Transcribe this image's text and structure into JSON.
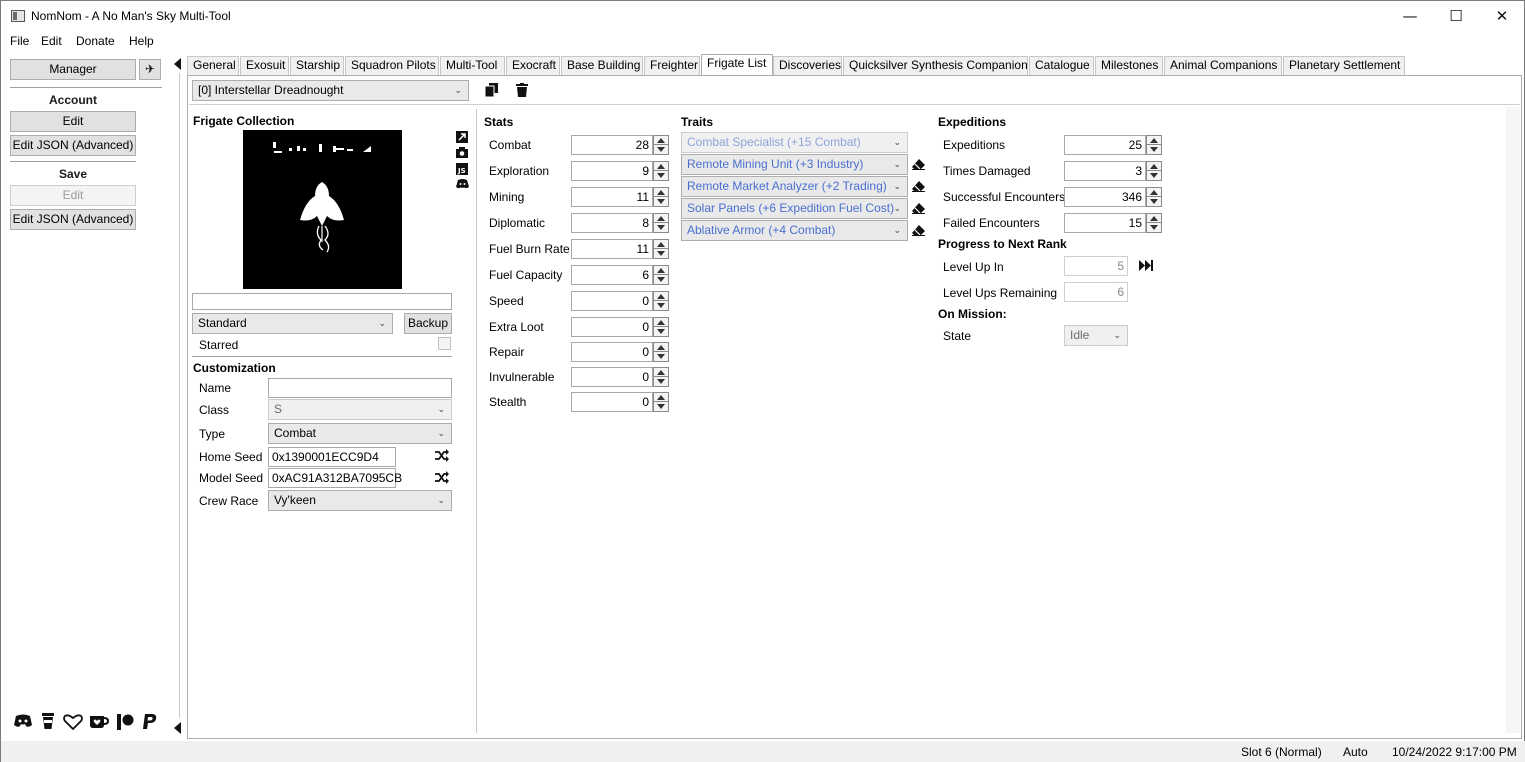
{
  "window": {
    "title": "NomNom - A No Man's Sky Multi-Tool",
    "minimize": "—",
    "maximize": "☐",
    "close": "✕"
  },
  "menu": [
    "File",
    "Edit",
    "Donate",
    "Help"
  ],
  "left": {
    "manager_label": "Manager",
    "account_label": "Account",
    "account_edit": "Edit",
    "account_edit_json": "Edit JSON (Advanced)",
    "save_label": "Save",
    "save_edit": "Edit",
    "save_edit_json": "Edit JSON (Advanced)"
  },
  "tabs": [
    "General",
    "Exosuit",
    "Starship",
    "Squadron Pilots",
    "Multi-Tool",
    "Exocraft",
    "Base Building",
    "Freighter",
    "Frigate List",
    "Discoveries",
    "Quicksilver Synthesis Companion",
    "Catalogue",
    "Milestones",
    "Animal Companions",
    "Planetary Settlement"
  ],
  "active_tab": "Frigate List",
  "frigate_selector": "[0] Interstellar Dreadnought",
  "collection": {
    "header": "Frigate Collection",
    "name_value": "",
    "mode": "Standard",
    "backup": "Backup",
    "starred": "Starred"
  },
  "customization": {
    "header": "Customization",
    "name_label": "Name",
    "name_value": "",
    "class_label": "Class",
    "class_value": "S",
    "type_label": "Type",
    "type_value": "Combat",
    "home_seed_label": "Home Seed",
    "home_seed_value": "0x1390001ECC9D4",
    "model_seed_label": "Model Seed",
    "model_seed_value": "0xAC91A312BA7095CB",
    "crew_race_label": "Crew Race",
    "crew_race_value": "Vy'keen"
  },
  "stats": {
    "header": "Stats",
    "items": [
      {
        "label": "Combat",
        "value": "28"
      },
      {
        "label": "Exploration",
        "value": "9"
      },
      {
        "label": "Mining",
        "value": "11"
      },
      {
        "label": "Diplomatic",
        "value": "8"
      },
      {
        "label": "Fuel Burn Rate",
        "value": "11"
      },
      {
        "label": "Fuel Capacity",
        "value": "6"
      },
      {
        "label": "Speed",
        "value": "0"
      },
      {
        "label": "Extra Loot",
        "value": "0"
      },
      {
        "label": "Repair",
        "value": "0"
      },
      {
        "label": "Invulnerable",
        "value": "0"
      },
      {
        "label": "Stealth",
        "value": "0"
      }
    ]
  },
  "traits": {
    "header": "Traits",
    "items": [
      "Combat Specialist (+15 Combat)",
      "Remote Mining Unit (+3 Industry)",
      "Remote Market Analyzer (+2 Trading)",
      "Solar Panels (+6 Expedition Fuel Cost)",
      "Ablative Armor (+4 Combat)"
    ]
  },
  "expeditions": {
    "header": "Expeditions",
    "items": [
      {
        "label": "Expeditions",
        "value": "25"
      },
      {
        "label": "Times Damaged",
        "value": "3"
      },
      {
        "label": "Successful Encounters",
        "value": "346"
      },
      {
        "label": "Failed Encounters",
        "value": "15"
      }
    ],
    "progress_header": "Progress to Next Rank",
    "level_up_label": "Level Up In",
    "level_up_value": "5",
    "level_ups_label": "Level Ups Remaining",
    "level_ups_value": "6",
    "mission_header": "On Mission:",
    "state_label": "State",
    "state_value": "Idle"
  },
  "status": {
    "slot": "Slot 6 (Normal)",
    "mode": "Auto",
    "datetime": "10/24/2022 9:17:00 PM"
  }
}
